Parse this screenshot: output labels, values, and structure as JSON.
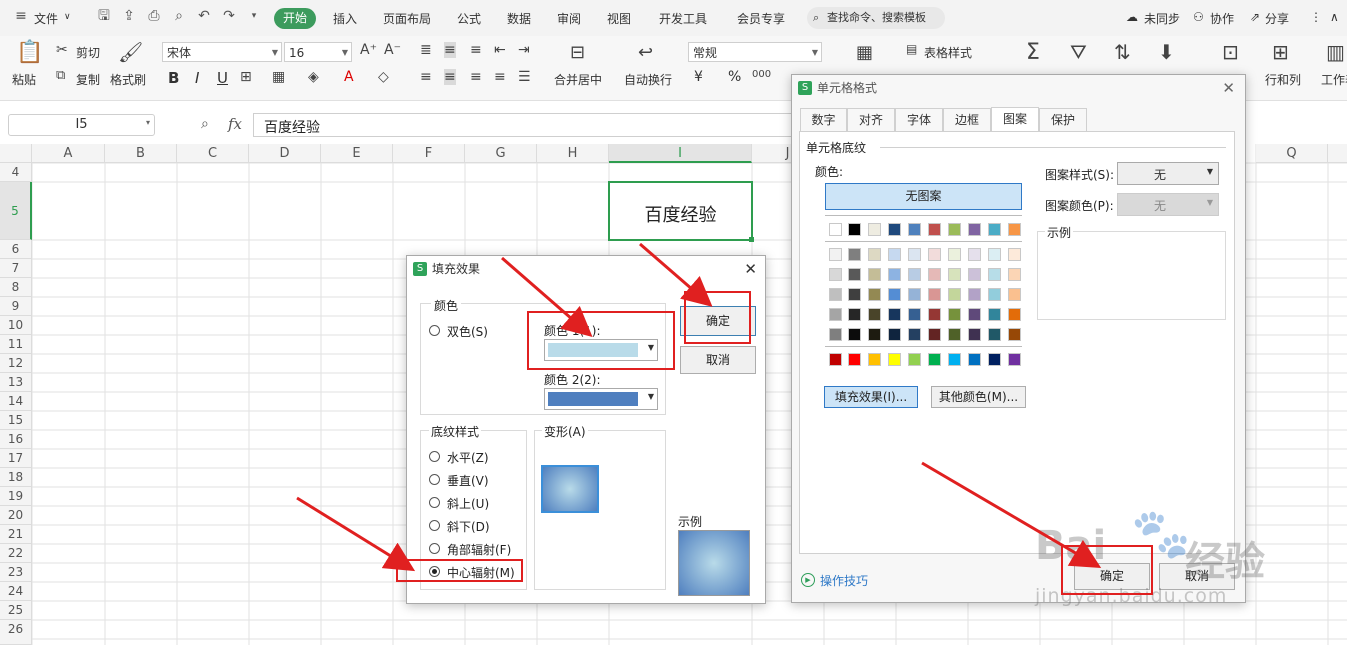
{
  "menubar": {
    "file": "文件",
    "tabs": [
      "开始",
      "插入",
      "页面布局",
      "公式",
      "数据",
      "审阅",
      "视图",
      "开发工具",
      "会员专享"
    ],
    "search_placeholder": "查找命令、搜索模板",
    "sync": "未同步",
    "collab": "协作",
    "share": "分享"
  },
  "ribbon": {
    "paste": "粘贴",
    "cut": "剪切",
    "copy": "复制",
    "format_painter": "格式刷",
    "font_name": "宋体",
    "font_size": "16",
    "bold": "B",
    "italic": "I",
    "underline": "U",
    "merge_center": "合并居中",
    "wrap_text": "自动换行",
    "number_format": "常规",
    "currency": "¥",
    "percent": "%",
    "table_style": "表格样式",
    "rows_cols": "行和列",
    "worksheet": "工作表"
  },
  "formula": {
    "cell_ref": "I5",
    "fx": "fx",
    "content": "百度经验"
  },
  "grid": {
    "columns": [
      "A",
      "B",
      "C",
      "D",
      "E",
      "F",
      "G",
      "H",
      "I",
      "J",
      "Q"
    ],
    "rows": [
      "4",
      "5",
      "6",
      "7",
      "8",
      "9",
      "10",
      "11",
      "12",
      "13",
      "14",
      "15",
      "16",
      "17",
      "18",
      "19",
      "20",
      "21",
      "22",
      "23",
      "24",
      "25",
      "26"
    ],
    "active_cell_text": "百度经验"
  },
  "fill_dialog": {
    "title": "填充效果",
    "color_group": "颜色",
    "two_color": "双色(S)",
    "color1_label": "颜色 1(1):",
    "color2_label": "颜色 2(2):",
    "color1_value": "#b9dbe9",
    "color2_value": "#4f7fbf",
    "ok": "确定",
    "cancel": "取消",
    "shading_group": "底纹样式",
    "styles": [
      "水平(Z)",
      "垂直(V)",
      "斜上(U)",
      "斜下(D)",
      "角部辐射(F)",
      "中心辐射(M)"
    ],
    "selected_style": "中心辐射(M)",
    "variants_label": "变形(A)",
    "sample_label": "示例"
  },
  "format_dialog": {
    "title": "单元格格式",
    "tabs": [
      "数字",
      "对齐",
      "字体",
      "边框",
      "图案",
      "保护"
    ],
    "active_tab": "图案",
    "section": "单元格底纹",
    "color_label": "颜色:",
    "no_pattern": "无图案",
    "pattern_style_label": "图案样式(S):",
    "pattern_style_value": "无",
    "pattern_color_label": "图案颜色(P):",
    "pattern_color_value": "无",
    "sample_label": "示例",
    "fill_effects": "填充效果(I)...",
    "more_colors": "其他颜色(M)...",
    "tips": "操作技巧",
    "ok": "确定",
    "cancel": "取消"
  },
  "palette": {
    "row1": [
      "#ffffff",
      "#000000",
      "#eeece1",
      "#1f497d",
      "#4f81bd",
      "#c0504d",
      "#9bbb59",
      "#8064a2",
      "#4bacc6",
      "#f79646"
    ],
    "tints": [
      [
        "#f2f2f2",
        "#7f7f7f",
        "#ddd9c3",
        "#c6d9f0",
        "#dbe5f1",
        "#f2dcdb",
        "#ebf1dd",
        "#e5e0ec",
        "#dbeef3",
        "#fdeada"
      ],
      [
        "#d8d8d8",
        "#595959",
        "#c4bd97",
        "#8db3e2",
        "#b8cce4",
        "#e5b9b7",
        "#d7e3bc",
        "#ccc1d9",
        "#b7dde8",
        "#fbd5b5"
      ],
      [
        "#bfbfbf",
        "#3f3f3f",
        "#938953",
        "#548dd4",
        "#95b3d7",
        "#d99694",
        "#c3d69b",
        "#b2a2c7",
        "#92cddc",
        "#fac08f"
      ],
      [
        "#a5a5a5",
        "#262626",
        "#494429",
        "#17365d",
        "#366092",
        "#953734",
        "#76923c",
        "#5f497a",
        "#31859b",
        "#e36c09"
      ],
      [
        "#7f7f7f",
        "#0c0c0c",
        "#1d1b10",
        "#0f243e",
        "#244061",
        "#632423",
        "#4f6128",
        "#3f3151",
        "#205867",
        "#974806"
      ]
    ],
    "standard": [
      "#c00000",
      "#ff0000",
      "#ffc000",
      "#ffff00",
      "#92d050",
      "#00b050",
      "#00b0f0",
      "#0070c0",
      "#002060",
      "#7030a0"
    ]
  },
  "watermark": {
    "brand": "Bai",
    "text": "经验",
    "url": "jingyan.baidu.com"
  },
  "colors": {
    "accent_green": "#3c9b5d",
    "selection_green": "#2e9d4f",
    "annotation_red": "#e02020"
  }
}
